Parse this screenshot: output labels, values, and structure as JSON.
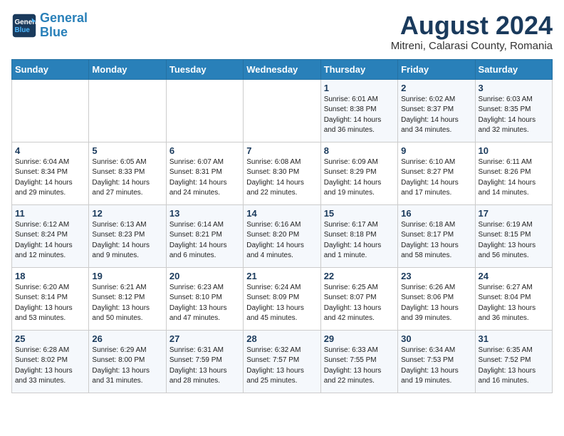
{
  "header": {
    "logo_line1": "General",
    "logo_line2": "Blue",
    "month_year": "August 2024",
    "location": "Mitreni, Calarasi County, Romania"
  },
  "weekdays": [
    "Sunday",
    "Monday",
    "Tuesday",
    "Wednesday",
    "Thursday",
    "Friday",
    "Saturday"
  ],
  "weeks": [
    [
      {
        "day": "",
        "info": ""
      },
      {
        "day": "",
        "info": ""
      },
      {
        "day": "",
        "info": ""
      },
      {
        "day": "",
        "info": ""
      },
      {
        "day": "1",
        "info": "Sunrise: 6:01 AM\nSunset: 8:38 PM\nDaylight: 14 hours\nand 36 minutes."
      },
      {
        "day": "2",
        "info": "Sunrise: 6:02 AM\nSunset: 8:37 PM\nDaylight: 14 hours\nand 34 minutes."
      },
      {
        "day": "3",
        "info": "Sunrise: 6:03 AM\nSunset: 8:35 PM\nDaylight: 14 hours\nand 32 minutes."
      }
    ],
    [
      {
        "day": "4",
        "info": "Sunrise: 6:04 AM\nSunset: 8:34 PM\nDaylight: 14 hours\nand 29 minutes."
      },
      {
        "day": "5",
        "info": "Sunrise: 6:05 AM\nSunset: 8:33 PM\nDaylight: 14 hours\nand 27 minutes."
      },
      {
        "day": "6",
        "info": "Sunrise: 6:07 AM\nSunset: 8:31 PM\nDaylight: 14 hours\nand 24 minutes."
      },
      {
        "day": "7",
        "info": "Sunrise: 6:08 AM\nSunset: 8:30 PM\nDaylight: 14 hours\nand 22 minutes."
      },
      {
        "day": "8",
        "info": "Sunrise: 6:09 AM\nSunset: 8:29 PM\nDaylight: 14 hours\nand 19 minutes."
      },
      {
        "day": "9",
        "info": "Sunrise: 6:10 AM\nSunset: 8:27 PM\nDaylight: 14 hours\nand 17 minutes."
      },
      {
        "day": "10",
        "info": "Sunrise: 6:11 AM\nSunset: 8:26 PM\nDaylight: 14 hours\nand 14 minutes."
      }
    ],
    [
      {
        "day": "11",
        "info": "Sunrise: 6:12 AM\nSunset: 8:24 PM\nDaylight: 14 hours\nand 12 minutes."
      },
      {
        "day": "12",
        "info": "Sunrise: 6:13 AM\nSunset: 8:23 PM\nDaylight: 14 hours\nand 9 minutes."
      },
      {
        "day": "13",
        "info": "Sunrise: 6:14 AM\nSunset: 8:21 PM\nDaylight: 14 hours\nand 6 minutes."
      },
      {
        "day": "14",
        "info": "Sunrise: 6:16 AM\nSunset: 8:20 PM\nDaylight: 14 hours\nand 4 minutes."
      },
      {
        "day": "15",
        "info": "Sunrise: 6:17 AM\nSunset: 8:18 PM\nDaylight: 14 hours\nand 1 minute."
      },
      {
        "day": "16",
        "info": "Sunrise: 6:18 AM\nSunset: 8:17 PM\nDaylight: 13 hours\nand 58 minutes."
      },
      {
        "day": "17",
        "info": "Sunrise: 6:19 AM\nSunset: 8:15 PM\nDaylight: 13 hours\nand 56 minutes."
      }
    ],
    [
      {
        "day": "18",
        "info": "Sunrise: 6:20 AM\nSunset: 8:14 PM\nDaylight: 13 hours\nand 53 minutes."
      },
      {
        "day": "19",
        "info": "Sunrise: 6:21 AM\nSunset: 8:12 PM\nDaylight: 13 hours\nand 50 minutes."
      },
      {
        "day": "20",
        "info": "Sunrise: 6:23 AM\nSunset: 8:10 PM\nDaylight: 13 hours\nand 47 minutes."
      },
      {
        "day": "21",
        "info": "Sunrise: 6:24 AM\nSunset: 8:09 PM\nDaylight: 13 hours\nand 45 minutes."
      },
      {
        "day": "22",
        "info": "Sunrise: 6:25 AM\nSunset: 8:07 PM\nDaylight: 13 hours\nand 42 minutes."
      },
      {
        "day": "23",
        "info": "Sunrise: 6:26 AM\nSunset: 8:06 PM\nDaylight: 13 hours\nand 39 minutes."
      },
      {
        "day": "24",
        "info": "Sunrise: 6:27 AM\nSunset: 8:04 PM\nDaylight: 13 hours\nand 36 minutes."
      }
    ],
    [
      {
        "day": "25",
        "info": "Sunrise: 6:28 AM\nSunset: 8:02 PM\nDaylight: 13 hours\nand 33 minutes."
      },
      {
        "day": "26",
        "info": "Sunrise: 6:29 AM\nSunset: 8:00 PM\nDaylight: 13 hours\nand 31 minutes."
      },
      {
        "day": "27",
        "info": "Sunrise: 6:31 AM\nSunset: 7:59 PM\nDaylight: 13 hours\nand 28 minutes."
      },
      {
        "day": "28",
        "info": "Sunrise: 6:32 AM\nSunset: 7:57 PM\nDaylight: 13 hours\nand 25 minutes."
      },
      {
        "day": "29",
        "info": "Sunrise: 6:33 AM\nSunset: 7:55 PM\nDaylight: 13 hours\nand 22 minutes."
      },
      {
        "day": "30",
        "info": "Sunrise: 6:34 AM\nSunset: 7:53 PM\nDaylight: 13 hours\nand 19 minutes."
      },
      {
        "day": "31",
        "info": "Sunrise: 6:35 AM\nSunset: 7:52 PM\nDaylight: 13 hours\nand 16 minutes."
      }
    ]
  ]
}
